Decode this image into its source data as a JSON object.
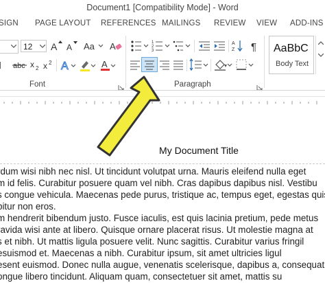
{
  "window": {
    "title": "Document1 [Compatibility Mode] - Word"
  },
  "ribbon": {
    "tabs": [
      "SIGN",
      "PAGE LAYOUT",
      "REFERENCES",
      "MAILINGS",
      "REVIEW",
      "VIEW",
      "ADD-INS"
    ],
    "font_size": "12",
    "style_preview": "AaBbC",
    "style_name": "Body Text",
    "groups": {
      "font": "Font",
      "paragraph": "Paragraph"
    }
  },
  "document": {
    "title": "My Document Title",
    "lines": [
      "rdum wisi nibh nec nisl. Ut tincidunt volutpat urna. Mauris eleifend nulla eget",
      "m id felis. Curabitur posuere quam vel nibh. Cras dapibus dapibus nisl. Vestibu",
      "s congue vehicula. Maecenas pede purus, tristique ac, tempus eget, egestas quis",
      "bitur non eros.",
      "m hendrerit bibendum justo. Fusce iaculis, est quis lacinia pretium, pede metus",
      "ravida wisi ante at libero. Quisque ornare placerat risus. Ut molestie magna at",
      "s et nibh. Ut mattis ligula posuere velit. Nunc sagittis. Curabitur varius fringil",
      "esuismod et. Maecenas a nibh. Curabitur ipsum, sit amet ultricies ligul",
      "esent euismod. Donec nulla augue, venenatis scelerisque, dapibus a, consequat",
      "ongue libero tincidunt. Aliquam quam, consectetuer sit amet, mattis su"
    ]
  },
  "colors": {
    "arrow_fill": "#f3ec3c",
    "arrow_stroke": "#333333",
    "highlight_bg": "#cde4f7",
    "highlight_border": "#6fa8dc",
    "text_color_bar": "#e03030"
  }
}
